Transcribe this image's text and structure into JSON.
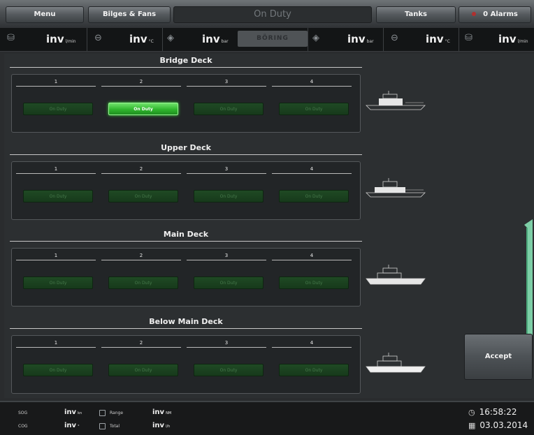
{
  "topbar": {
    "menu_label": "Menu",
    "bilges_label": "Bilges & Fans",
    "title": "On Duty",
    "tanks_label": "Tanks",
    "alarms_label": "0 Alarms"
  },
  "sensorbar": {
    "mode_label": "BÖRING",
    "items": [
      {
        "icon": "tank-icon",
        "glyph": "⛁",
        "value": "inv",
        "unit": "l/min"
      },
      {
        "icon": "thermometer-icon",
        "glyph": "⊖",
        "value": "inv",
        "unit": "°C"
      },
      {
        "icon": "pressure-icon",
        "glyph": "◈",
        "value": "inv",
        "unit": "bar"
      },
      {
        "icon": "pressure-icon",
        "glyph": "◈",
        "value": "inv",
        "unit": "bar"
      },
      {
        "icon": "thermometer-icon",
        "glyph": "⊖",
        "value": "inv",
        "unit": "°C"
      },
      {
        "icon": "tank-icon",
        "glyph": "⛁",
        "value": "inv",
        "unit": "l/min"
      }
    ]
  },
  "decks": [
    {
      "title": "Bridge Deck",
      "zones": [
        {
          "number": "1",
          "label": "On Duty",
          "active": false
        },
        {
          "number": "2",
          "label": "On Duty",
          "active": true
        },
        {
          "number": "3",
          "label": "On Duty",
          "active": false
        },
        {
          "number": "4",
          "label": "On Duty",
          "active": false
        }
      ]
    },
    {
      "title": "Upper Deck",
      "zones": [
        {
          "number": "1",
          "label": "On Duty",
          "active": false
        },
        {
          "number": "2",
          "label": "On Duty",
          "active": false
        },
        {
          "number": "3",
          "label": "On Duty",
          "active": false
        },
        {
          "number": "4",
          "label": "On Duty",
          "active": false
        }
      ]
    },
    {
      "title": "Main Deck",
      "zones": [
        {
          "number": "1",
          "label": "On Duty",
          "active": false
        },
        {
          "number": "2",
          "label": "On Duty",
          "active": false
        },
        {
          "number": "3",
          "label": "On Duty",
          "active": false
        },
        {
          "number": "4",
          "label": "On Duty",
          "active": false
        }
      ]
    },
    {
      "title": "Below Main Deck",
      "zones": [
        {
          "number": "1",
          "label": "On Duty",
          "active": false
        },
        {
          "number": "2",
          "label": "On Duty",
          "active": false
        },
        {
          "number": "3",
          "label": "On Duty",
          "active": false
        },
        {
          "number": "4",
          "label": "On Duty",
          "active": false
        }
      ]
    }
  ],
  "accept_label": "Accept",
  "bottombar": {
    "sog_label": "SOG",
    "sog_value": "inv",
    "sog_unit": "kn",
    "cog_label": "COG",
    "cog_value": "inv",
    "cog_unit": "°",
    "range_label": "Range",
    "range_value": "inv",
    "range_unit": "NM",
    "total_label": "Total",
    "total_value": "inv",
    "total_unit": "l/h",
    "time": "16:58:22",
    "date": "03.03.2014"
  },
  "colors": {
    "active_green": "#3ddc3a",
    "inactive_green": "#1f4a24",
    "accent_edge": "#86e0b4"
  }
}
